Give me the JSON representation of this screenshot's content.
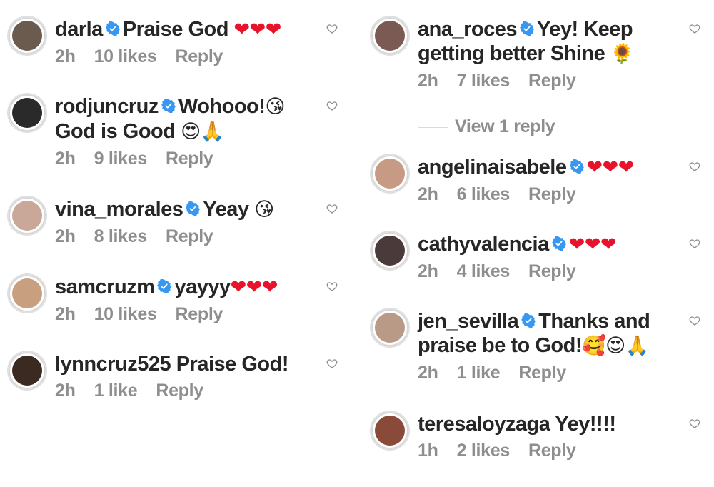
{
  "left_comments": [
    {
      "username": "darla",
      "verified": true,
      "text": "Praise God",
      "emoji": "❤❤❤",
      "time": "2h",
      "likes": "10 likes",
      "reply": "Reply",
      "avatar_color": "#6b5a4e"
    },
    {
      "username": "rodjuncruz",
      "verified": true,
      "text": "Wohooo!",
      "emoji": "😘",
      "text2": "God is Good",
      "emoji2": "😍🙏",
      "time": "2h",
      "likes": "9 likes",
      "reply": "Reply",
      "avatar_color": "#2a2a2a"
    },
    {
      "username": "vina_morales",
      "verified": true,
      "text": "Yeay",
      "emoji": "😘",
      "time": "2h",
      "likes": "8 likes",
      "reply": "Reply",
      "avatar_color": "#c9a89a"
    },
    {
      "username": "samcruzm",
      "verified": true,
      "text": "yayyy",
      "emoji": "❤❤❤",
      "time": "2h",
      "likes": "10 likes",
      "reply": "Reply",
      "avatar_color": "#c8a07f"
    },
    {
      "username": "lynncruz525",
      "verified": false,
      "text": "Praise God!",
      "emoji": "",
      "time": "2h",
      "likes": "1 like",
      "reply": "Reply",
      "avatar_color": "#3b2a22"
    }
  ],
  "right_comments": [
    {
      "username": "ana_roces",
      "verified": true,
      "text": "Yey! Keep",
      "text2": "getting better Shine",
      "emoji2": "🌻",
      "time": "2h",
      "likes": "7 likes",
      "reply": "Reply",
      "avatar_color": "#7a5a52"
    },
    {
      "username": "angelinaisabele",
      "verified": true,
      "text": "",
      "emoji": "❤❤❤",
      "time": "2h",
      "likes": "6 likes",
      "reply": "Reply",
      "avatar_color": "#c79a86"
    },
    {
      "username": "cathyvalencia",
      "verified": true,
      "text": "",
      "emoji": "❤❤❤",
      "time": "2h",
      "likes": "4 likes",
      "reply": "Reply",
      "avatar_color": "#4a3a3a"
    },
    {
      "username": "jen_sevilla",
      "verified": true,
      "text": "Thanks and",
      "text2": "praise be to God!",
      "emoji2": "🥰😍🙏",
      "time": "2h",
      "likes": "1 like",
      "reply": "Reply",
      "avatar_color": "#b89a86"
    },
    {
      "username": "teresaloyzaga",
      "verified": false,
      "text": "Yey!!!!",
      "emoji": "",
      "time": "1h",
      "likes": "2 likes",
      "reply": "Reply",
      "avatar_color": "#8a4a3a"
    }
  ],
  "view_replies": "View 1 reply",
  "colors": {
    "verified_blue": "#3897f0",
    "meta_gray": "#8e8e8e",
    "heart_red": "#e8132b"
  }
}
